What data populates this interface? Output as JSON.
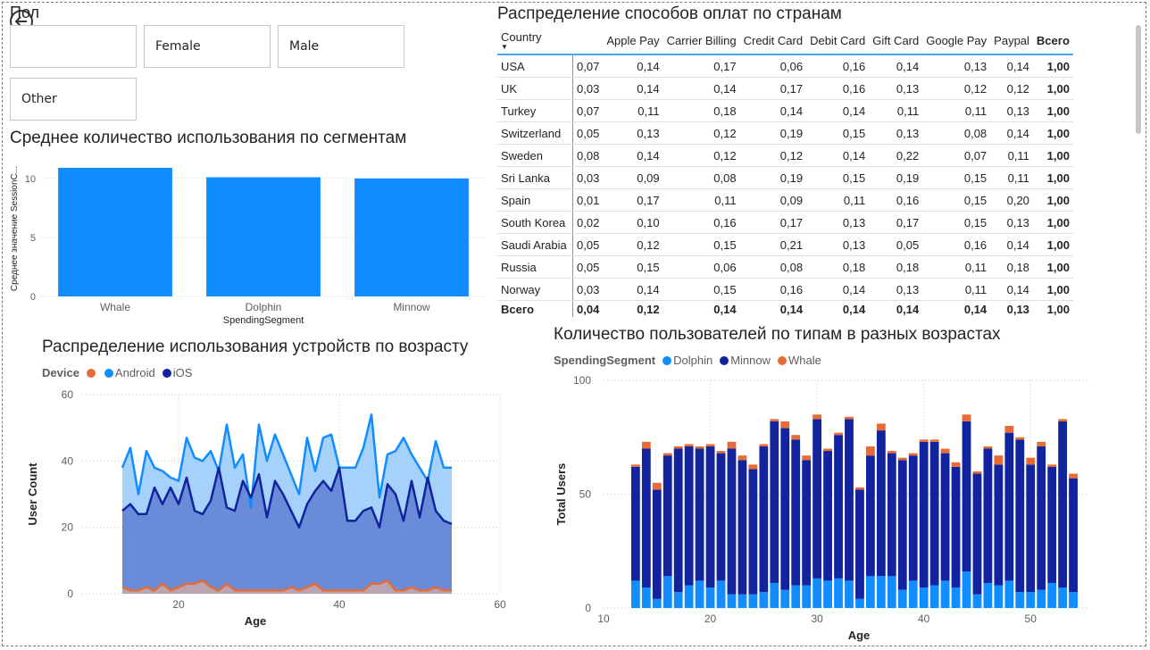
{
  "slicer": {
    "title": "Пол",
    "options": [
      "",
      "Female",
      "Male",
      "Other"
    ]
  },
  "chart_data": [
    {
      "type": "bar",
      "title": "Среднее количество использования по сегментам",
      "xlabel": "SpendingSegment",
      "ylabel": "Среднее значение SessionC...",
      "categories": [
        "Whale",
        "Dolphin",
        "Minnow"
      ],
      "values": [
        10.9,
        10.1,
        10.0
      ],
      "ylim": [
        0,
        11.5
      ],
      "yticks": [
        0,
        5,
        10
      ],
      "color": "#118dff"
    },
    {
      "type": "area",
      "title": "Распределение использования устройств по возрасту",
      "legend_title": "Device",
      "xlabel": "Age",
      "ylabel": "User Count",
      "xlim": [
        8,
        60
      ],
      "ylim": [
        0,
        60
      ],
      "xticks": [
        20,
        40,
        60
      ],
      "yticks": [
        0,
        20,
        40,
        60
      ],
      "x": [
        13,
        14,
        15,
        16,
        17,
        18,
        19,
        20,
        21,
        22,
        23,
        24,
        25,
        26,
        27,
        28,
        29,
        30,
        31,
        32,
        33,
        34,
        35,
        36,
        37,
        38,
        39,
        40,
        41,
        42,
        43,
        44,
        45,
        46,
        47,
        48,
        49,
        50,
        51,
        52,
        53,
        54
      ],
      "series": [
        {
          "name": "Android",
          "color": "#e66c37",
          "values": [
            2,
            1,
            1,
            2,
            1,
            3,
            1,
            2,
            3,
            3,
            4,
            2,
            1,
            3,
            1,
            1,
            1,
            1,
            1,
            1,
            1,
            2,
            1,
            2,
            3,
            1,
            1,
            1,
            1,
            1,
            1,
            3,
            3,
            4,
            1,
            1,
            2,
            1,
            1,
            2,
            1,
            1
          ]
        },
        {
          "name": "Android",
          "color": "#118dff",
          "values": [
            38,
            44,
            30,
            43,
            38,
            37,
            35,
            34,
            47,
            41,
            40,
            43,
            37,
            51,
            38,
            42,
            26,
            51,
            40,
            48,
            42,
            36,
            30,
            47,
            37,
            47,
            48,
            38,
            38,
            38,
            44,
            54,
            29,
            42,
            43,
            47,
            42,
            38,
            34,
            46,
            38,
            38
          ]
        },
        {
          "name": "iOS",
          "color": "#12239e",
          "values": [
            25,
            27,
            24,
            24,
            32,
            27,
            32,
            27,
            35,
            25,
            24,
            28,
            38,
            26,
            25,
            34,
            29,
            36,
            23,
            34,
            30,
            25,
            20,
            27,
            31,
            34,
            31,
            38,
            22,
            22,
            25,
            26,
            20,
            33,
            30,
            22,
            34,
            23,
            35,
            25,
            22,
            21
          ]
        }
      ]
    },
    {
      "type": "bar",
      "stacked": true,
      "title": "Количество пользователей по типам в разных возрастах",
      "legend_title": "SpendingSegment",
      "xlabel": "Age",
      "ylabel": "Total Users",
      "xlim": [
        10,
        55.5
      ],
      "ylim": [
        0,
        100
      ],
      "xticks": [
        10,
        20,
        30,
        40,
        50
      ],
      "yticks": [
        0,
        50,
        100
      ],
      "x": [
        13,
        14,
        15,
        16,
        17,
        18,
        19,
        20,
        21,
        22,
        23,
        24,
        25,
        26,
        27,
        28,
        29,
        30,
        31,
        32,
        33,
        34,
        35,
        36,
        37,
        38,
        39,
        40,
        41,
        42,
        43,
        44,
        45,
        46,
        47,
        48,
        49,
        50,
        51,
        52,
        53,
        54
      ],
      "series": [
        {
          "name": "Dolphin",
          "color": "#118dff",
          "values": [
            12,
            9,
            4,
            14,
            7,
            10,
            12,
            9,
            12,
            6,
            6,
            6,
            7,
            11,
            8,
            10,
            10,
            13,
            12,
            13,
            12,
            4,
            14,
            14,
            14,
            8,
            12,
            9,
            10,
            12,
            9,
            16,
            6,
            11,
            10,
            12,
            7,
            7,
            8,
            11,
            9,
            7
          ]
        },
        {
          "name": "Minnow",
          "color": "#12239e",
          "values": [
            50,
            61,
            48,
            53,
            63,
            61,
            58,
            62,
            56,
            64,
            59,
            55,
            64,
            71,
            71,
            64,
            55,
            70,
            57,
            63,
            71,
            48,
            53,
            64,
            54,
            57,
            55,
            64,
            63,
            56,
            53,
            66,
            53,
            59,
            53,
            65,
            67,
            56,
            63,
            51,
            73,
            50
          ]
        },
        {
          "name": "Whale",
          "color": "#e66c37",
          "values": [
            1,
            3,
            3,
            1,
            1,
            1,
            1,
            1,
            1,
            3,
            2,
            2,
            1,
            1,
            3,
            2,
            2,
            2,
            1,
            1,
            1,
            1,
            4,
            3,
            1,
            1,
            1,
            1,
            1,
            2,
            2,
            3,
            1,
            1,
            4,
            3,
            1,
            3,
            2,
            1,
            1,
            2
          ]
        }
      ]
    }
  ],
  "matrix": {
    "title": "Распределение способов оплат по странам",
    "columns": [
      "Country",
      "",
      "Apple Pay",
      "Carrier Billing",
      "Credit Card",
      "Debit Card",
      "Gift Card",
      "Google Pay",
      "Paypal",
      "Всего"
    ],
    "rows": [
      [
        "USA",
        "0,07",
        "0,14",
        "0,17",
        "0,06",
        "0,16",
        "0,14",
        "0,13",
        "0,14",
        "1,00"
      ],
      [
        "UK",
        "0,03",
        "0,14",
        "0,14",
        "0,17",
        "0,16",
        "0,13",
        "0,12",
        "0,12",
        "1,00"
      ],
      [
        "Turkey",
        "0,07",
        "0,11",
        "0,18",
        "0,14",
        "0,14",
        "0,11",
        "0,11",
        "0,13",
        "1,00"
      ],
      [
        "Switzerland",
        "0,05",
        "0,13",
        "0,12",
        "0,19",
        "0,15",
        "0,13",
        "0,08",
        "0,14",
        "1,00"
      ],
      [
        "Sweden",
        "0,08",
        "0,14",
        "0,12",
        "0,12",
        "0,14",
        "0,22",
        "0,07",
        "0,11",
        "1,00"
      ],
      [
        "Sri Lanka",
        "0,03",
        "0,09",
        "0,08",
        "0,19",
        "0,15",
        "0,19",
        "0,15",
        "0,11",
        "1,00"
      ],
      [
        "Spain",
        "0,01",
        "0,17",
        "0,11",
        "0,09",
        "0,11",
        "0,16",
        "0,15",
        "0,20",
        "1,00"
      ],
      [
        "South Korea",
        "0,02",
        "0,10",
        "0,16",
        "0,17",
        "0,13",
        "0,17",
        "0,15",
        "0,13",
        "1,00"
      ],
      [
        "Saudi Arabia",
        "0,05",
        "0,12",
        "0,15",
        "0,21",
        "0,13",
        "0,05",
        "0,16",
        "0,14",
        "1,00"
      ],
      [
        "Russia",
        "0,05",
        "0,15",
        "0,06",
        "0,08",
        "0,18",
        "0,18",
        "0,11",
        "0,18",
        "1,00"
      ],
      [
        "Norway",
        "0,03",
        "0,14",
        "0,15",
        "0,16",
        "0,14",
        "0,13",
        "0,11",
        "0,14",
        "1,00"
      ]
    ],
    "total": [
      "Всего",
      "0,04",
      "0,12",
      "0,14",
      "0,14",
      "0,14",
      "0,14",
      "0,14",
      "0,13",
      "1,00"
    ]
  }
}
